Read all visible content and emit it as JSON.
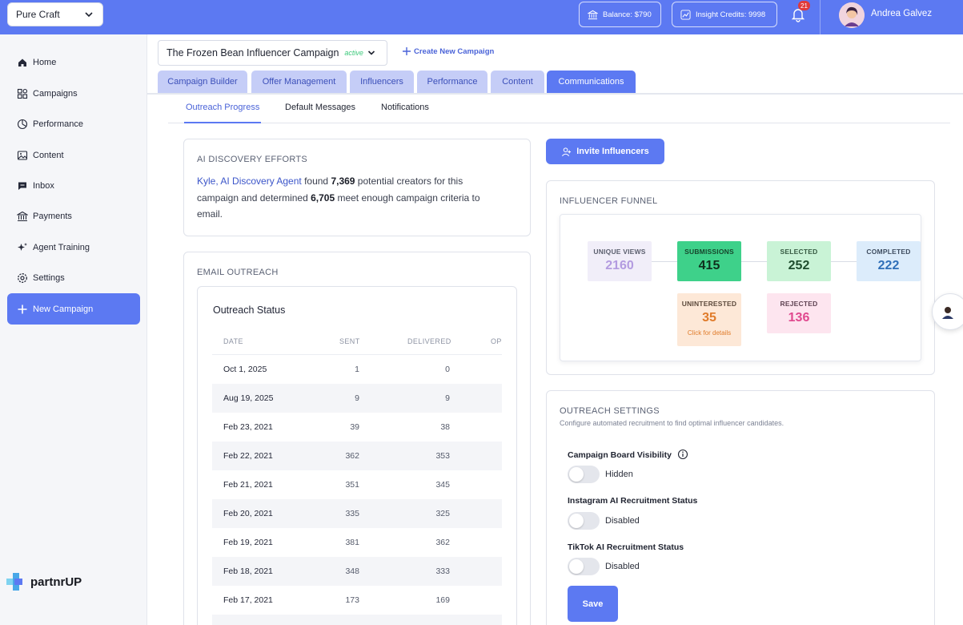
{
  "topbar": {
    "org_select": "Pure Craft",
    "balance": "Balance: $790",
    "insight_credits": "Insight Credits: 9998",
    "notifications_count": "21",
    "user_name": "Andrea Galvez"
  },
  "sidebar": {
    "items": [
      {
        "label": "Home",
        "icon": "home-icon"
      },
      {
        "label": "Campaigns",
        "icon": "campaigns-icon"
      },
      {
        "label": "Performance",
        "icon": "performance-icon"
      },
      {
        "label": "Content",
        "icon": "image-icon"
      },
      {
        "label": "Inbox",
        "icon": "chat-icon"
      },
      {
        "label": "Payments",
        "icon": "bank-icon"
      },
      {
        "label": "Agent Training",
        "icon": "sparkle-icon"
      },
      {
        "label": "Settings",
        "icon": "gear-icon"
      }
    ],
    "new_campaign": "New Campaign",
    "logo": "partnrUP"
  },
  "campaign": {
    "name": "The Frozen Bean Influencer Campaign",
    "status": "active",
    "create_new": "Create New Campaign"
  },
  "tabs": [
    "Campaign Builder",
    "Offer Management",
    "Influencers",
    "Performance",
    "Content",
    "Communications"
  ],
  "active_tab": "Communications",
  "subtabs": [
    "Outreach Progress",
    "Default Messages",
    "Notifications"
  ],
  "active_subtab": "Outreach Progress",
  "ai_discovery": {
    "title": "AI DISCOVERY EFFORTS",
    "agent": "Kyle, AI Discovery Agent",
    "t1": " found ",
    "found": "7,369",
    "t2": " potential creators for this campaign and determined ",
    "meet": "6,705",
    "t3": " meet enough campaign criteria to email."
  },
  "email_outreach": {
    "title": "EMAIL OUTREACH",
    "status_title": "Outreach Status",
    "columns": [
      "DATE",
      "SENT",
      "DELIVERED",
      "OP"
    ],
    "rows": [
      {
        "date": "Oct 1, 2025",
        "sent": "1",
        "delivered": "0"
      },
      {
        "date": "Aug 19, 2025",
        "sent": "9",
        "delivered": "9"
      },
      {
        "date": "Feb 23, 2021",
        "sent": "39",
        "delivered": "38"
      },
      {
        "date": "Feb 22, 2021",
        "sent": "362",
        "delivered": "353"
      },
      {
        "date": "Feb 21, 2021",
        "sent": "351",
        "delivered": "345"
      },
      {
        "date": "Feb 20, 2021",
        "sent": "335",
        "delivered": "325"
      },
      {
        "date": "Feb 19, 2021",
        "sent": "381",
        "delivered": "362"
      },
      {
        "date": "Feb 18, 2021",
        "sent": "348",
        "delivered": "333"
      },
      {
        "date": "Feb 17, 2021",
        "sent": "173",
        "delivered": "169"
      }
    ]
  },
  "invite_button": "Invite Influencers",
  "funnel": {
    "title": "INFLUENCER FUNNEL",
    "unique_views": {
      "label": "UNIQUE VIEWS",
      "value": "2160"
    },
    "submissions": {
      "label": "SUBMISSIONS",
      "value": "415"
    },
    "selected": {
      "label": "SELECTED",
      "value": "252"
    },
    "completed": {
      "label": "COMPLETED",
      "value": "222"
    },
    "uninterested": {
      "label": "UNINTERESTED",
      "value": "35",
      "sub": "Click for details"
    },
    "rejected": {
      "label": "REJECTED",
      "value": "136"
    }
  },
  "outreach_settings": {
    "title": "OUTREACH SETTINGS",
    "subtitle": "Configure automated recruitment to find optimal influencer candidates.",
    "board_visibility": {
      "label": "Campaign Board Visibility",
      "state": "Hidden"
    },
    "instagram": {
      "label": "Instagram AI Recruitment Status",
      "state": "Disabled"
    },
    "tiktok": {
      "label": "TikTok AI Recruitment Status",
      "state": "Disabled"
    },
    "save": "Save"
  },
  "colors": {
    "primary": "#5c79f2",
    "active_status": "#3cc97b",
    "submissions_bg": "#3ed18a",
    "selected_bg": "#c9f3d6",
    "completed_bg": "#dcecfb",
    "unique_views_bg": "#f1eef9",
    "uninterested_bg": "#fde8d7",
    "rejected_bg": "#fde5ef"
  }
}
